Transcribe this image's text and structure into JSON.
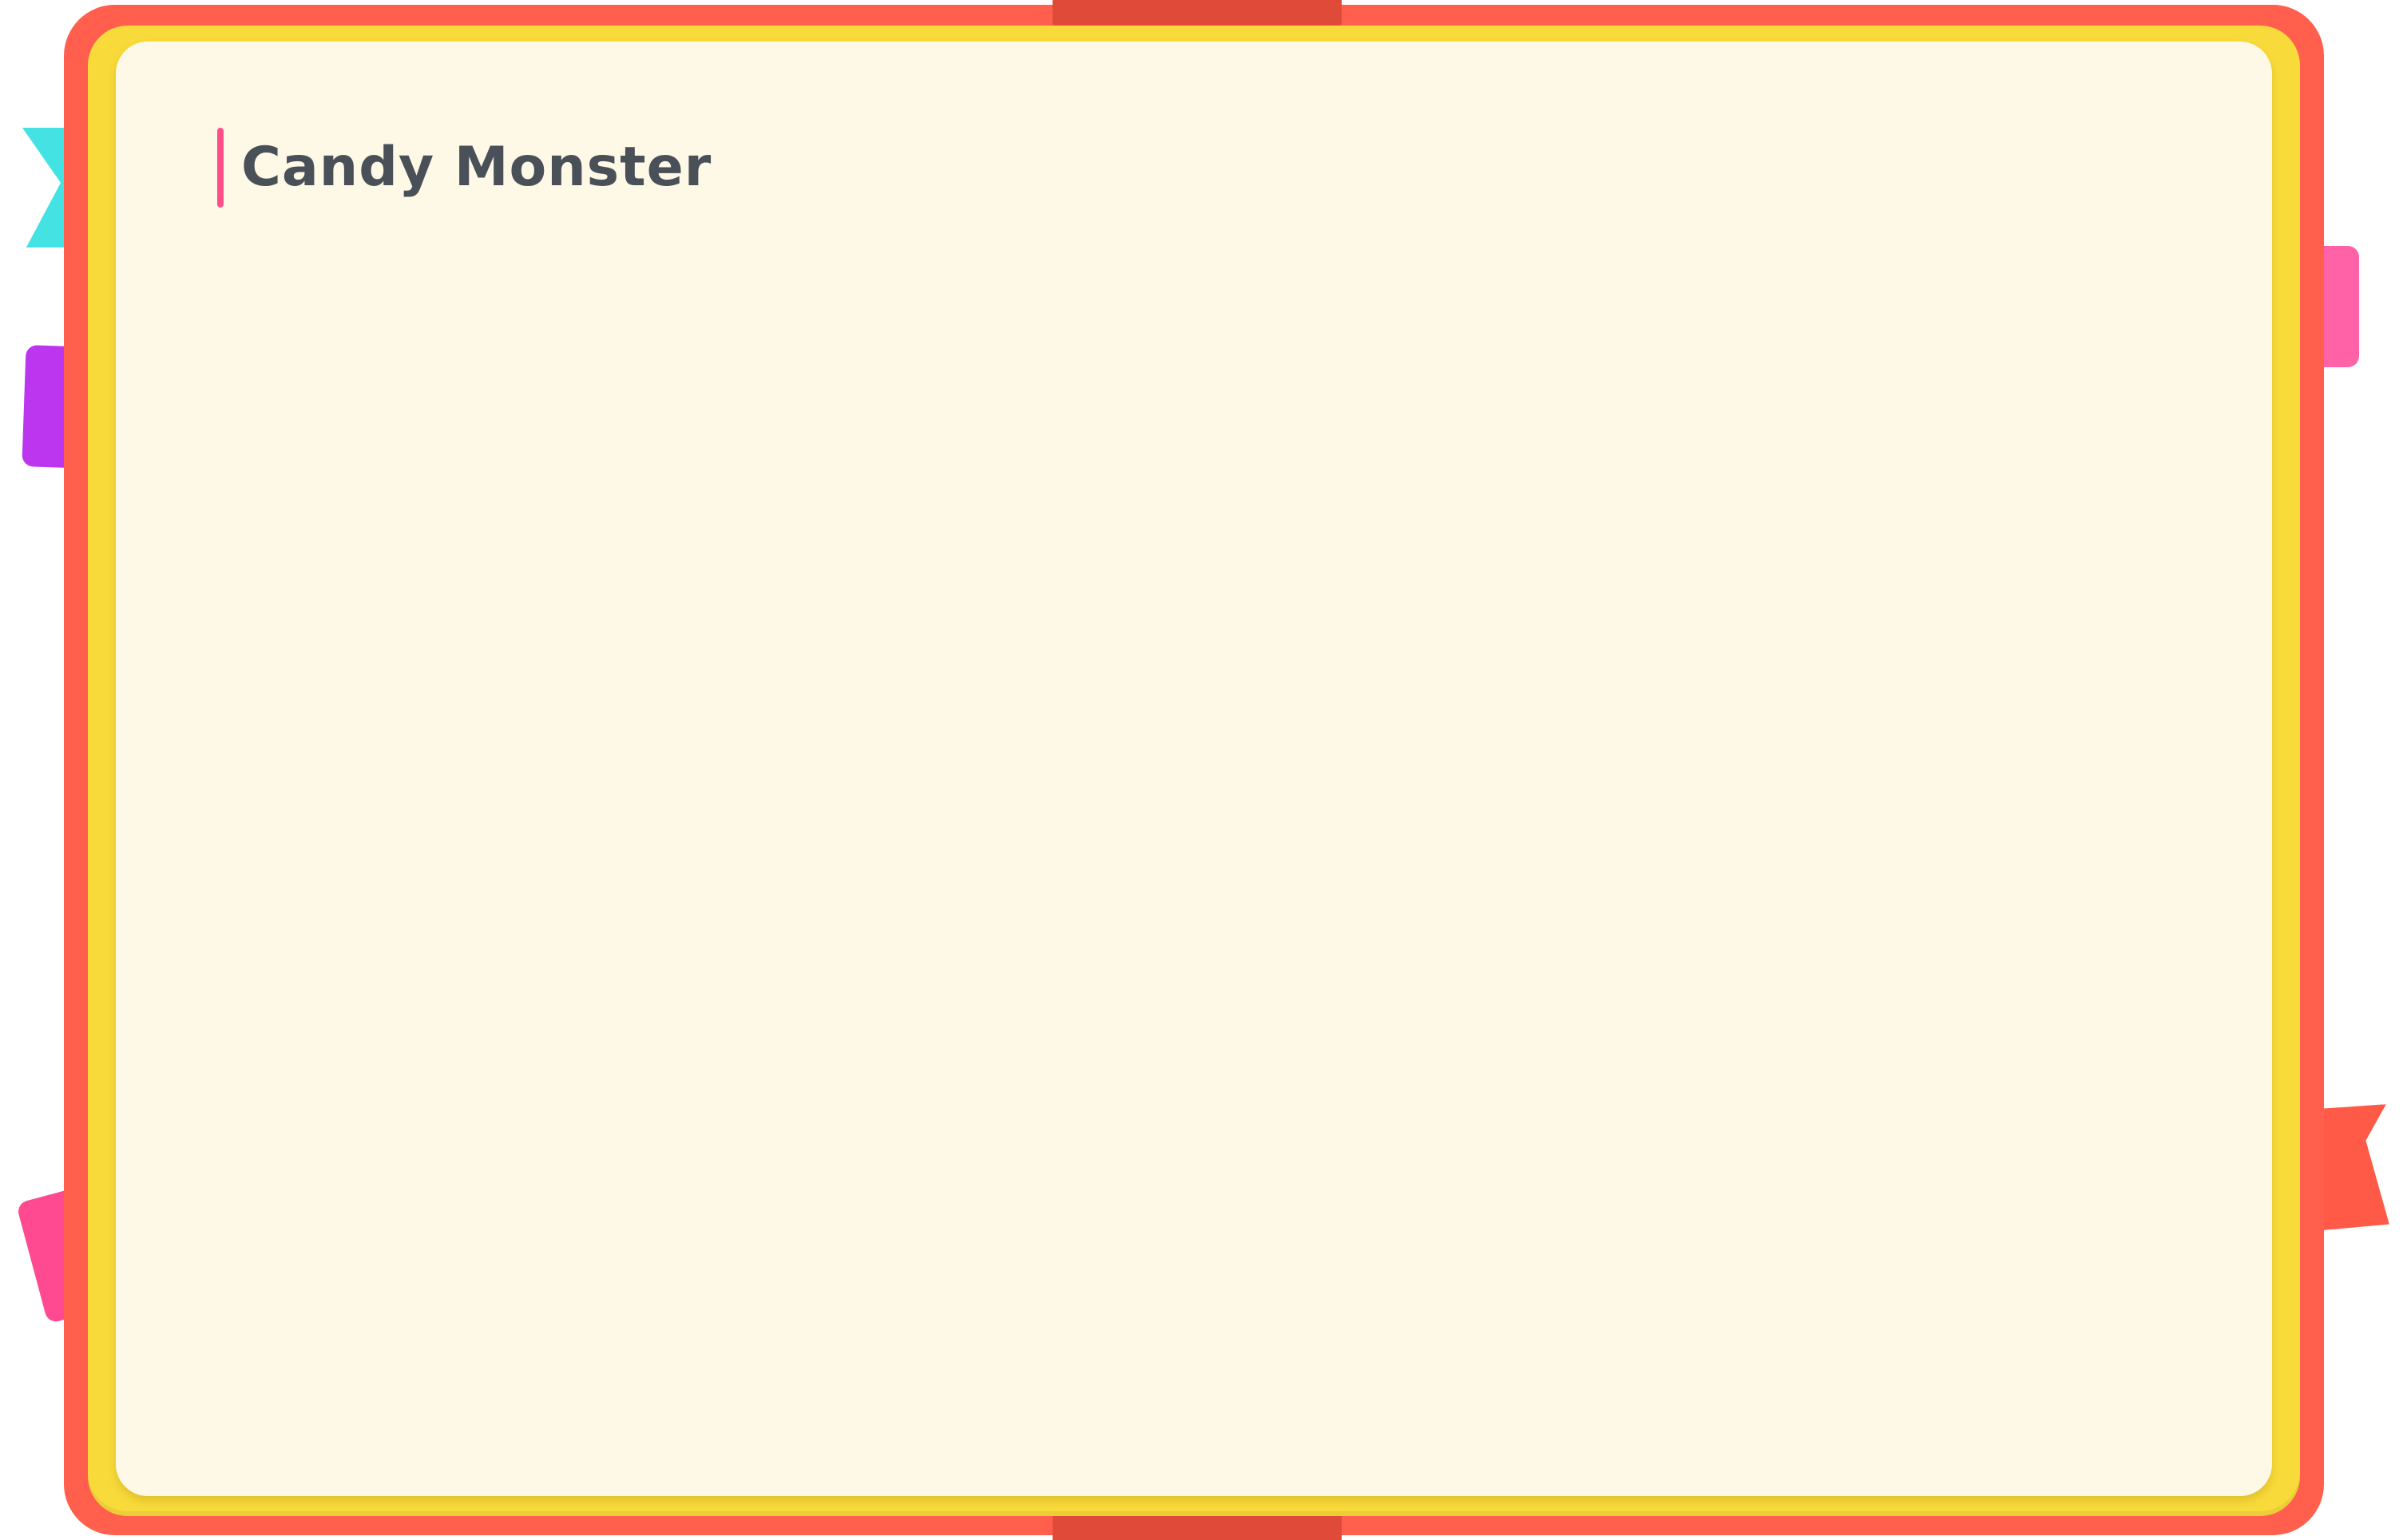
{
  "page": {
    "title": "Candy Monster"
  },
  "colors": {
    "frame_outer": "#ff5f4c",
    "frame_inner": "#f8da3a",
    "paper": "#fef8e6",
    "title_text": "#4a5058",
    "title_accent": "#ff4f8a",
    "clip": "#e04a38",
    "tab_cyan": "#44e2e2",
    "tab_purple": "#bb36ee",
    "tab_pink_left": "#ff4a92",
    "tab_pink_right": "#ff62a6",
    "tab_red_right": "#ff5a48"
  }
}
